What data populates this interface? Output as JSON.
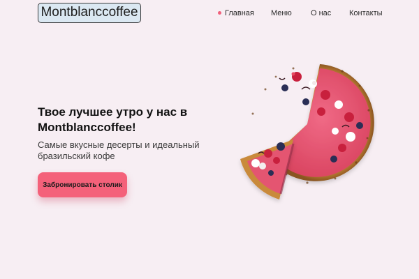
{
  "header": {
    "logo_text": "Montblanccoffee",
    "nav": [
      {
        "label": "Главная",
        "active": true
      },
      {
        "label": "Меню",
        "active": false
      },
      {
        "label": "О нас",
        "active": false
      },
      {
        "label": "Контакты",
        "active": false
      }
    ]
  },
  "hero": {
    "title": "Твое лучшее утро у нас в Montblanccoffee!",
    "subtitle": "Самые вкусные десерты и идеальный бразильский кофе",
    "cta_label": "Забронировать столик"
  },
  "colors": {
    "background": "#f7eef3",
    "accent": "#f4617a",
    "logo_background": "#dbe8f2",
    "active_dot": "#f0607b"
  },
  "images": {
    "hero_image": "raspberry-tart-with-slice-cut"
  }
}
